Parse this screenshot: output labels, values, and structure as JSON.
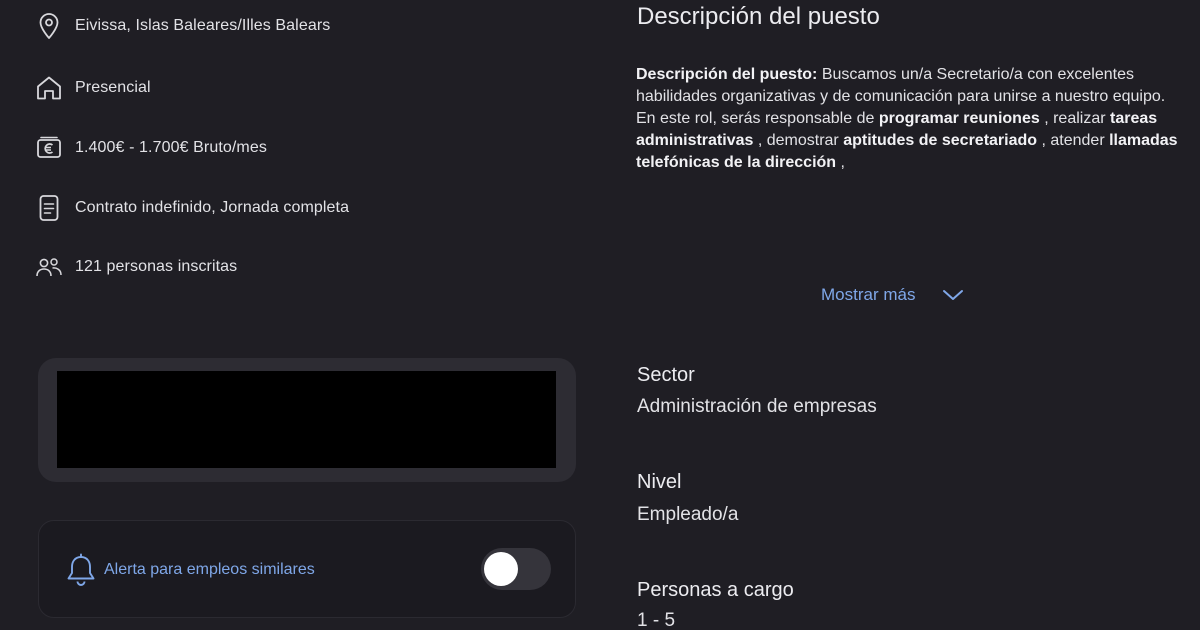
{
  "details": {
    "location": "Eivissa, Islas Baleares/Illes Balears",
    "workplace": "Presencial",
    "salary": "1.400€ - 1.700€ Bruto/mes",
    "contract": "Contrato indefinido, Jornada completa",
    "applicants": "121 personas inscritas",
    "icons": [
      "location-pin-icon",
      "home-icon",
      "euro-banknote-icon",
      "document-icon",
      "people-icon"
    ]
  },
  "alert": {
    "label": "Alerta para empleos similares",
    "toggle_on": false
  },
  "description": {
    "title": "Descripción del puesto",
    "segments": [
      {
        "text": "Descripción del puesto:",
        "bold": true
      },
      {
        "text": " Buscamos un/a Secretario/a con excelentes habilidades organizativas y de comunicación para unirse a nuestro equipo. En este rol, serás responsable de ",
        "bold": false
      },
      {
        "text": "programar reuniones",
        "bold": true
      },
      {
        "text": " , realizar ",
        "bold": false
      },
      {
        "text": "tareas administrativas",
        "bold": true
      },
      {
        "text": " , demostrar ",
        "bold": false
      },
      {
        "text": "aptitudes de secretariado",
        "bold": true
      },
      {
        "text": " , atender ",
        "bold": false
      },
      {
        "text": "llamadas telefónicas de la dirección",
        "bold": true
      },
      {
        "text": " ,",
        "bold": false
      }
    ],
    "show_more_label": "Mostrar más"
  },
  "fields": {
    "sector_label": "Sector",
    "sector_value": "Administración de empresas",
    "level_label": "Nivel",
    "level_value": "Empleado/a",
    "reports_label": "Personas a cargo",
    "reports_value": "1 - 5"
  },
  "colors": {
    "background": "#1f1e24",
    "accent_link": "#7fa7e8",
    "card": "#2d2c33",
    "redaction": "#000000"
  }
}
